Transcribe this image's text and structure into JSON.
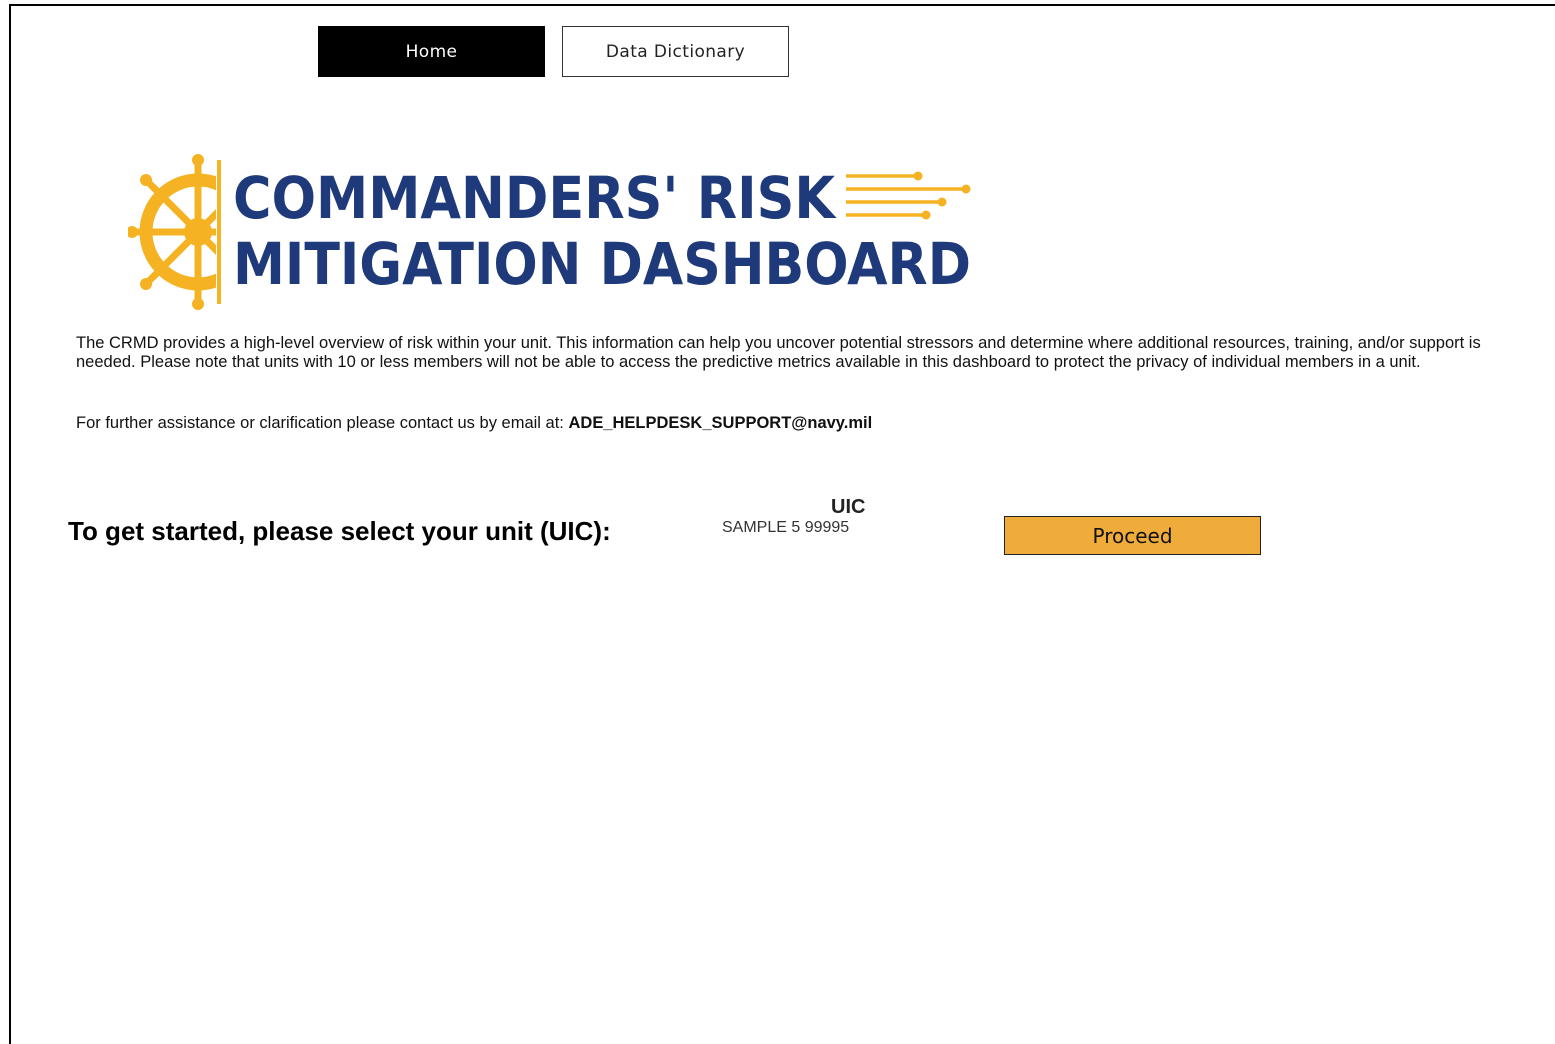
{
  "nav": {
    "home_label": "Home",
    "dictionary_label": "Data Dictionary"
  },
  "logo": {
    "line1": "COMMANDERS' RISK",
    "line2": "MITIGATION DASHBOARD",
    "icon": "ship-wheel-icon",
    "title_color": "#1f3a7a",
    "accent_color": "#f5b323"
  },
  "intro": {
    "text": "The CRMD provides a high-level overview of risk within your unit. This information can help you uncover potential stressors and determine where additional resources, training, and/or support is needed. Please note that units with 10 or less members will not be able to access the predictive metrics available in this dashboard to protect the privacy of individual members in a unit."
  },
  "contact": {
    "text": "For further assistance or clarification please contact us by email at:",
    "email": "ADE_HELPDESK_SUPPORT@navy.mil"
  },
  "selector": {
    "prompt": "To get started, please select your unit (UIC):",
    "uic_label": "UIC",
    "uic_value": "SAMPLE 5 99995"
  },
  "proceed": {
    "label": "Proceed",
    "color": "#f0ac3a"
  }
}
